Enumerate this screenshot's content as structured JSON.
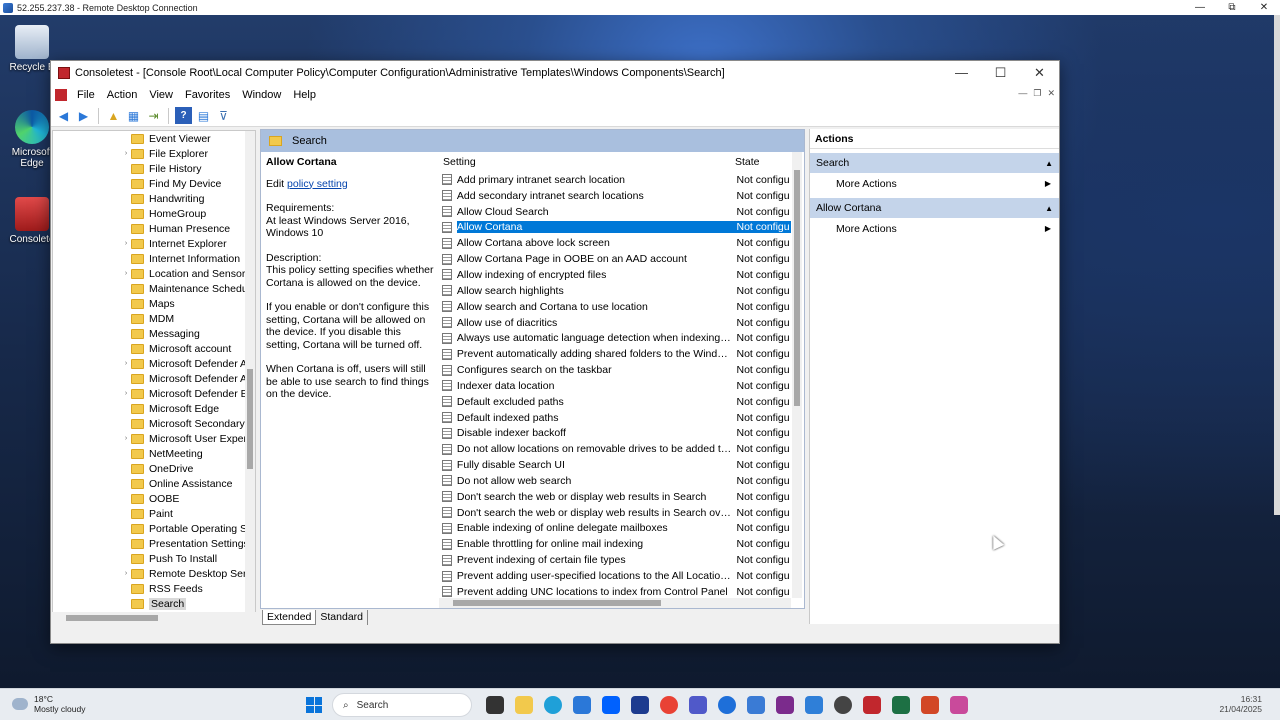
{
  "rdp": {
    "title": "52.255.237.38 - Remote Desktop Connection",
    "minimize": "—",
    "maximize": "⧉",
    "close": "✕"
  },
  "desktop": {
    "icons": [
      {
        "label": "Recycle B"
      },
      {
        "label": "Microsoft Edge"
      },
      {
        "label": "Consolete"
      }
    ]
  },
  "mmc": {
    "title": "Consoletest - [Console Root\\Local Computer Policy\\Computer Configuration\\Administrative Templates\\Windows Components\\Search]",
    "window_controls": {
      "minimize": "—",
      "maximize": "☐",
      "close": "✕"
    },
    "menu": [
      "File",
      "Action",
      "View",
      "Favorites",
      "Window",
      "Help"
    ],
    "tree": [
      {
        "label": "Event Viewer",
        "expandable": false
      },
      {
        "label": "File Explorer",
        "expandable": true
      },
      {
        "label": "File History",
        "expandable": false
      },
      {
        "label": "Find My Device",
        "expandable": false
      },
      {
        "label": "Handwriting",
        "expandable": false
      },
      {
        "label": "HomeGroup",
        "expandable": false
      },
      {
        "label": "Human Presence",
        "expandable": false
      },
      {
        "label": "Internet Explorer",
        "expandable": true
      },
      {
        "label": "Internet Information",
        "expandable": false
      },
      {
        "label": "Location and Sensors",
        "expandable": true
      },
      {
        "label": "Maintenance Schedu",
        "expandable": false
      },
      {
        "label": "Maps",
        "expandable": false
      },
      {
        "label": "MDM",
        "expandable": false
      },
      {
        "label": "Messaging",
        "expandable": false
      },
      {
        "label": "Microsoft account",
        "expandable": false
      },
      {
        "label": "Microsoft Defender A",
        "expandable": true
      },
      {
        "label": "Microsoft Defender A",
        "expandable": false
      },
      {
        "label": "Microsoft Defender E",
        "expandable": true
      },
      {
        "label": "Microsoft Edge",
        "expandable": false
      },
      {
        "label": "Microsoft Secondary",
        "expandable": false
      },
      {
        "label": "Microsoft User Exper",
        "expandable": true
      },
      {
        "label": "NetMeeting",
        "expandable": false
      },
      {
        "label": "OneDrive",
        "expandable": false
      },
      {
        "label": "Online Assistance",
        "expandable": false
      },
      {
        "label": "OOBE",
        "expandable": false
      },
      {
        "label": "Paint",
        "expandable": false
      },
      {
        "label": "Portable Operating S",
        "expandable": false
      },
      {
        "label": "Presentation Settings",
        "expandable": false
      },
      {
        "label": "Push To Install",
        "expandable": false
      },
      {
        "label": "Remote Desktop Serv",
        "expandable": true
      },
      {
        "label": "RSS Feeds",
        "expandable": false
      },
      {
        "label": "Search",
        "expandable": false,
        "selected": true
      }
    ],
    "center": {
      "header": "Search",
      "description": {
        "title": "Allow Cortana",
        "edit_prefix": "Edit",
        "edit_link": "policy setting",
        "requirements_label": "Requirements:",
        "requirements": "At least Windows Server 2016, Windows 10",
        "description_label": "Description:",
        "description": "This policy setting specifies whether Cortana is allowed on the device.",
        "para2": "If you enable or don't configure this setting, Cortana will be allowed on the device. If you disable this setting, Cortana will be turned off.",
        "para3": "When Cortana is off, users will still be able to use search to find things on the device."
      },
      "columns": {
        "setting": "Setting",
        "state": "State"
      },
      "settings": [
        {
          "name": "Add primary intranet search location",
          "state": "Not configu"
        },
        {
          "name": "Add secondary intranet search locations",
          "state": "Not configu"
        },
        {
          "name": "Allow Cloud Search",
          "state": "Not configu"
        },
        {
          "name": "Allow Cortana",
          "state": "Not configu",
          "selected": true
        },
        {
          "name": "Allow Cortana above lock screen",
          "state": "Not configu"
        },
        {
          "name": "Allow Cortana Page in OOBE on an AAD account",
          "state": "Not configu"
        },
        {
          "name": "Allow indexing of encrypted files",
          "state": "Not configu"
        },
        {
          "name": "Allow search highlights",
          "state": "Not configu"
        },
        {
          "name": "Allow search and Cortana to use location",
          "state": "Not configu"
        },
        {
          "name": "Allow use of diacritics",
          "state": "Not configu"
        },
        {
          "name": "Always use automatic language detection when indexing con...",
          "state": "Not configu"
        },
        {
          "name": "Prevent automatically adding shared folders to the Windows ...",
          "state": "Not configu"
        },
        {
          "name": "Configures search on the taskbar",
          "state": "Not configu"
        },
        {
          "name": "Indexer data location",
          "state": "Not configu"
        },
        {
          "name": "Default excluded paths",
          "state": "Not configu"
        },
        {
          "name": "Default indexed paths",
          "state": "Not configu"
        },
        {
          "name": "Disable indexer backoff",
          "state": "Not configu"
        },
        {
          "name": "Do not allow locations on removable drives to be added to li...",
          "state": "Not configu"
        },
        {
          "name": "Fully disable Search UI",
          "state": "Not configu"
        },
        {
          "name": "Do not allow web search",
          "state": "Not configu"
        },
        {
          "name": "Don't search the web or display web results in Search",
          "state": "Not configu"
        },
        {
          "name": "Don't search the web or display web results in Search over m...",
          "state": "Not configu"
        },
        {
          "name": "Enable indexing of online delegate mailboxes",
          "state": "Not configu"
        },
        {
          "name": "Enable throttling for online mail indexing",
          "state": "Not configu"
        },
        {
          "name": "Prevent indexing of certain file types",
          "state": "Not configu"
        },
        {
          "name": "Prevent adding user-specified locations to the All Locations ...",
          "state": "Not configu"
        },
        {
          "name": "Prevent adding UNC locations to index from Control Panel",
          "state": "Not configu"
        }
      ],
      "tabs": {
        "extended": "Extended",
        "standard": "Standard"
      }
    },
    "actions": {
      "header": "Actions",
      "sections": [
        {
          "title": "Search",
          "item": "More Actions"
        },
        {
          "title": "Allow Cortana",
          "item": "More Actions"
        }
      ]
    }
  },
  "taskbar": {
    "weather_temp": "18°C",
    "weather_desc": "Mostly cloudy",
    "search_placeholder": "Search",
    "time": "16:31",
    "date": "21/04/2025"
  }
}
